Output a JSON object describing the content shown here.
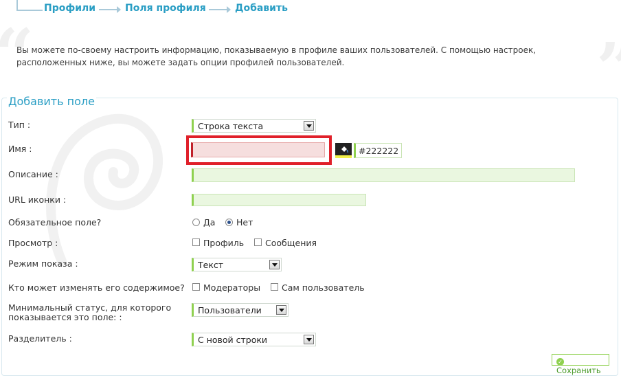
{
  "breadcrumb": {
    "items": [
      "Профили",
      "Поля профиля",
      "Добавить"
    ]
  },
  "intro": {
    "text": "Вы можете по-своему настроить информацию, показываемую в профиле ваших пользователей. С помощью настроек, расположенных ниже, вы можете задать опции профилей пользователей."
  },
  "form": {
    "title": "Добавить поле",
    "type": {
      "label": "Тип :",
      "value": "Строка текста"
    },
    "name": {
      "label": "Имя :",
      "value": "",
      "color_value": "#222222"
    },
    "description": {
      "label": "Описание :",
      "value": ""
    },
    "icon_url": {
      "label": "URL иконки :",
      "value": ""
    },
    "required": {
      "label": "Обязательное поле?",
      "options": [
        "Да",
        "Нет"
      ],
      "selected": "Нет"
    },
    "view": {
      "label": "Просмотр :",
      "options": [
        "Профиль",
        "Сообщения"
      ]
    },
    "display_mode": {
      "label": "Режим показа :",
      "value": "Текст"
    },
    "editors": {
      "label": "Кто может изменять его содержимое?",
      "options": [
        "Модераторы",
        "Сам пользователь"
      ]
    },
    "min_status": {
      "label_line1": "Минимальный статус, для которого",
      "label_line2": "показывается это поле: :",
      "value": "Пользователи"
    },
    "separator": {
      "label": "Разделитель :",
      "value": "С новой строки"
    },
    "save_label": "Сохранить"
  },
  "colors": {
    "accent_blue": "#2a9ec4",
    "accent_green": "#8fd14f",
    "highlight_red": "#e0202a"
  }
}
